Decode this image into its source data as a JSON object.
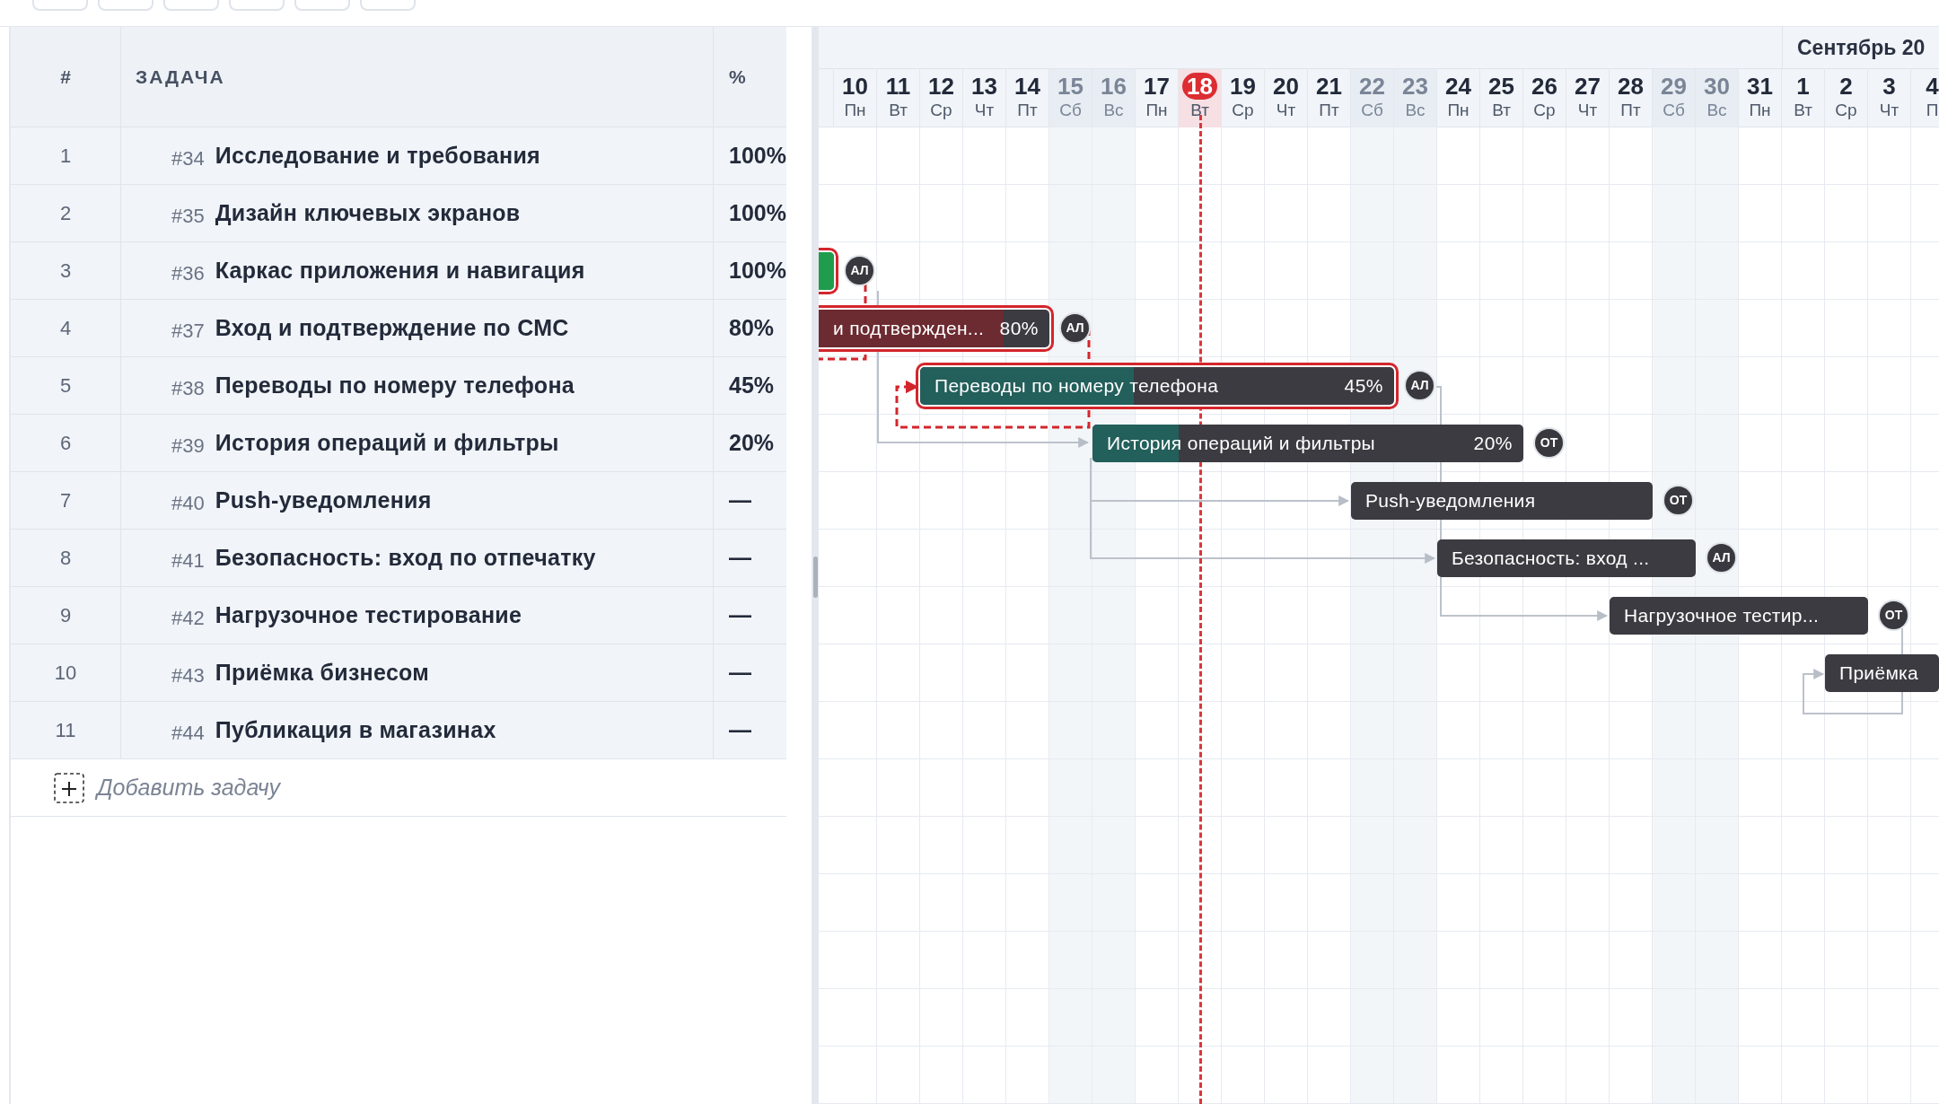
{
  "toolbar": {
    "buttons": [
      {
        "kind": "button"
      },
      {
        "kind": "button"
      },
      {
        "kind": "button"
      },
      {
        "kind": "button"
      },
      {
        "kind": "button"
      },
      {
        "kind": "button"
      }
    ]
  },
  "task_table": {
    "columns": [
      "#",
      "ЗАДАЧА",
      "%"
    ],
    "rows": [
      {
        "num": "1",
        "id": "#34",
        "name": "Исследование и требования",
        "percent": "100%"
      },
      {
        "num": "2",
        "id": "#35",
        "name": "Дизайн ключевых экранов",
        "percent": "100%"
      },
      {
        "num": "3",
        "id": "#36",
        "name": "Каркас приложения и навигация",
        "percent": "100%"
      },
      {
        "num": "4",
        "id": "#37",
        "name": "Вход и подтверждение по СМС",
        "percent": "80%"
      },
      {
        "num": "5",
        "id": "#38",
        "name": "Переводы по номеру телефона",
        "percent": "45%"
      },
      {
        "num": "6",
        "id": "#39",
        "name": "История операций и фильтры",
        "percent": "20%"
      },
      {
        "num": "7",
        "id": "#40",
        "name": "Push-уведомления",
        "percent": "—"
      },
      {
        "num": "8",
        "id": "#41",
        "name": "Безопасность: вход по отпечатку",
        "percent": "—"
      },
      {
        "num": "9",
        "id": "#42",
        "name": "Нагрузочное тестирование",
        "percent": "—"
      },
      {
        "num": "10",
        "id": "#43",
        "name": "Приёмка бизнесом",
        "percent": "—"
      },
      {
        "num": "11",
        "id": "#44",
        "name": "Публикация в магазинах",
        "percent": "—"
      }
    ],
    "add_task": "Добавить задачу"
  },
  "timeline": {
    "month": "Сентябрь 20",
    "days": [
      {
        "day": "10",
        "weekday": "Пн",
        "weekend": false,
        "today": false
      },
      {
        "day": "11",
        "weekday": "Вт",
        "weekend": false,
        "today": false
      },
      {
        "day": "12",
        "weekday": "Ср",
        "weekend": false,
        "today": false
      },
      {
        "day": "13",
        "weekday": "Чт",
        "weekend": false,
        "today": false
      },
      {
        "day": "14",
        "weekday": "Пт",
        "weekend": false,
        "today": false
      },
      {
        "day": "15",
        "weekday": "Сб",
        "weekend": true,
        "today": false
      },
      {
        "day": "16",
        "weekday": "Вс",
        "weekend": true,
        "today": false
      },
      {
        "day": "17",
        "weekday": "Пн",
        "weekend": false,
        "today": false
      },
      {
        "day": "18",
        "weekday": "Вт",
        "weekend": false,
        "today": true
      },
      {
        "day": "19",
        "weekday": "Ср",
        "weekend": false,
        "today": false
      },
      {
        "day": "20",
        "weekday": "Чт",
        "weekend": false,
        "today": false
      },
      {
        "day": "21",
        "weekday": "Пт",
        "weekend": false,
        "today": false
      },
      {
        "day": "22",
        "weekday": "Сб",
        "weekend": true,
        "today": false
      },
      {
        "day": "23",
        "weekday": "Вс",
        "weekend": true,
        "today": false
      },
      {
        "day": "24",
        "weekday": "Пн",
        "weekend": false,
        "today": false
      },
      {
        "day": "25",
        "weekday": "Вт",
        "weekend": false,
        "today": false
      },
      {
        "day": "26",
        "weekday": "Ср",
        "weekend": false,
        "today": false
      },
      {
        "day": "27",
        "weekday": "Чт",
        "weekend": false,
        "today": false
      },
      {
        "day": "28",
        "weekday": "Пт",
        "weekend": false,
        "today": false
      },
      {
        "day": "29",
        "weekday": "Сб",
        "weekend": true,
        "today": false
      },
      {
        "day": "30",
        "weekday": "Вс",
        "weekend": true,
        "today": false
      },
      {
        "day": "31",
        "weekday": "Пн",
        "weekend": false,
        "today": false
      },
      {
        "day": "1",
        "weekday": "Вт",
        "weekend": false,
        "today": false
      },
      {
        "day": "2",
        "weekday": "Ср",
        "weekend": false,
        "today": false
      },
      {
        "day": "3",
        "weekday": "Чт",
        "weekend": false,
        "today": false
      },
      {
        "day": "4",
        "weekday": "П",
        "weekend": false,
        "today": false
      }
    ],
    "bars": [
      {
        "kind": "done",
        "critical": true,
        "level": 1,
        "assignee": "АЛ"
      },
      {
        "label": "и подтвержден...",
        "percent": "80%",
        "kind": "overdue",
        "critical": true,
        "level": 0.8,
        "assignee": "АЛ"
      },
      {
        "label": "Переводы по номеру телефона",
        "percent": "45%",
        "kind": "in_progress",
        "critical": true,
        "level": 0.45,
        "assignee": "АЛ"
      },
      {
        "label": "История операций и фильтры",
        "percent": "20%",
        "kind": "in_progress",
        "critical": false,
        "level": 0.2,
        "assignee": "ОТ"
      },
      {
        "label": "Push-уведомления",
        "kind": "planned",
        "critical": false,
        "level": 0,
        "assignee": "ОТ"
      },
      {
        "label": "Безопасность: вход ...",
        "kind": "planned",
        "critical": false,
        "level": 0,
        "assignee": "АЛ"
      },
      {
        "label": "Нагрузочное тестир...",
        "kind": "planned",
        "critical": false,
        "level": 0,
        "assignee": "ОТ"
      },
      {
        "label": "Приёмка",
        "kind": "planned",
        "critical": false,
        "level": 0
      }
    ]
  }
}
